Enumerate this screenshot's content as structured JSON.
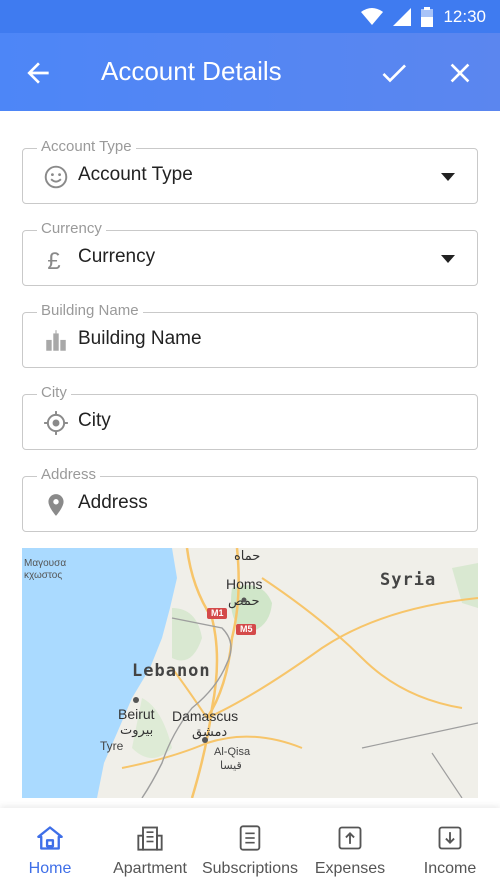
{
  "status_bar": {
    "time": "12:30"
  },
  "app_bar": {
    "title": "Account Details"
  },
  "form": {
    "fields": [
      {
        "legend": "Account Type",
        "value": "Account Type",
        "icon": "smiley-icon",
        "dropdown": true
      },
      {
        "legend": "Currency",
        "value": "Currency",
        "icon": "pound-icon",
        "dropdown": true
      },
      {
        "legend": "Building Name",
        "value": "Building Name",
        "icon": "building-icon",
        "dropdown": false
      },
      {
        "legend": "City",
        "value": "City",
        "icon": "location-target-icon",
        "dropdown": false
      },
      {
        "legend": "Address",
        "value": "Address",
        "icon": "map-pin-icon",
        "dropdown": false
      }
    ]
  },
  "map": {
    "labels": {
      "country1": "Syria",
      "country2": "Lebanon",
      "city1": "Homs",
      "city1_ar": "حمص",
      "city2": "Beirut",
      "city2_ar": "بيروت",
      "city3": "Damascus",
      "city3_ar": "دمشق",
      "city4": "Tyre",
      "city5": "Al-Qisa",
      "city5_ar": "قيسا",
      "city6_ar": "حماه",
      "road1": "M1",
      "road2": "M5",
      "sea": "Μαγουσα",
      "sea2": "κχωστος"
    }
  },
  "bottom_nav": {
    "items": [
      {
        "label": "Home",
        "active": true
      },
      {
        "label": "Apartment",
        "active": false
      },
      {
        "label": "Subscriptions",
        "active": false
      },
      {
        "label": "Expenses",
        "active": false
      },
      {
        "label": "Income",
        "active": false
      }
    ]
  },
  "colors": {
    "primary": "#4d86f7",
    "active_nav": "#3f6fe8",
    "sea": "#aadaff"
  }
}
